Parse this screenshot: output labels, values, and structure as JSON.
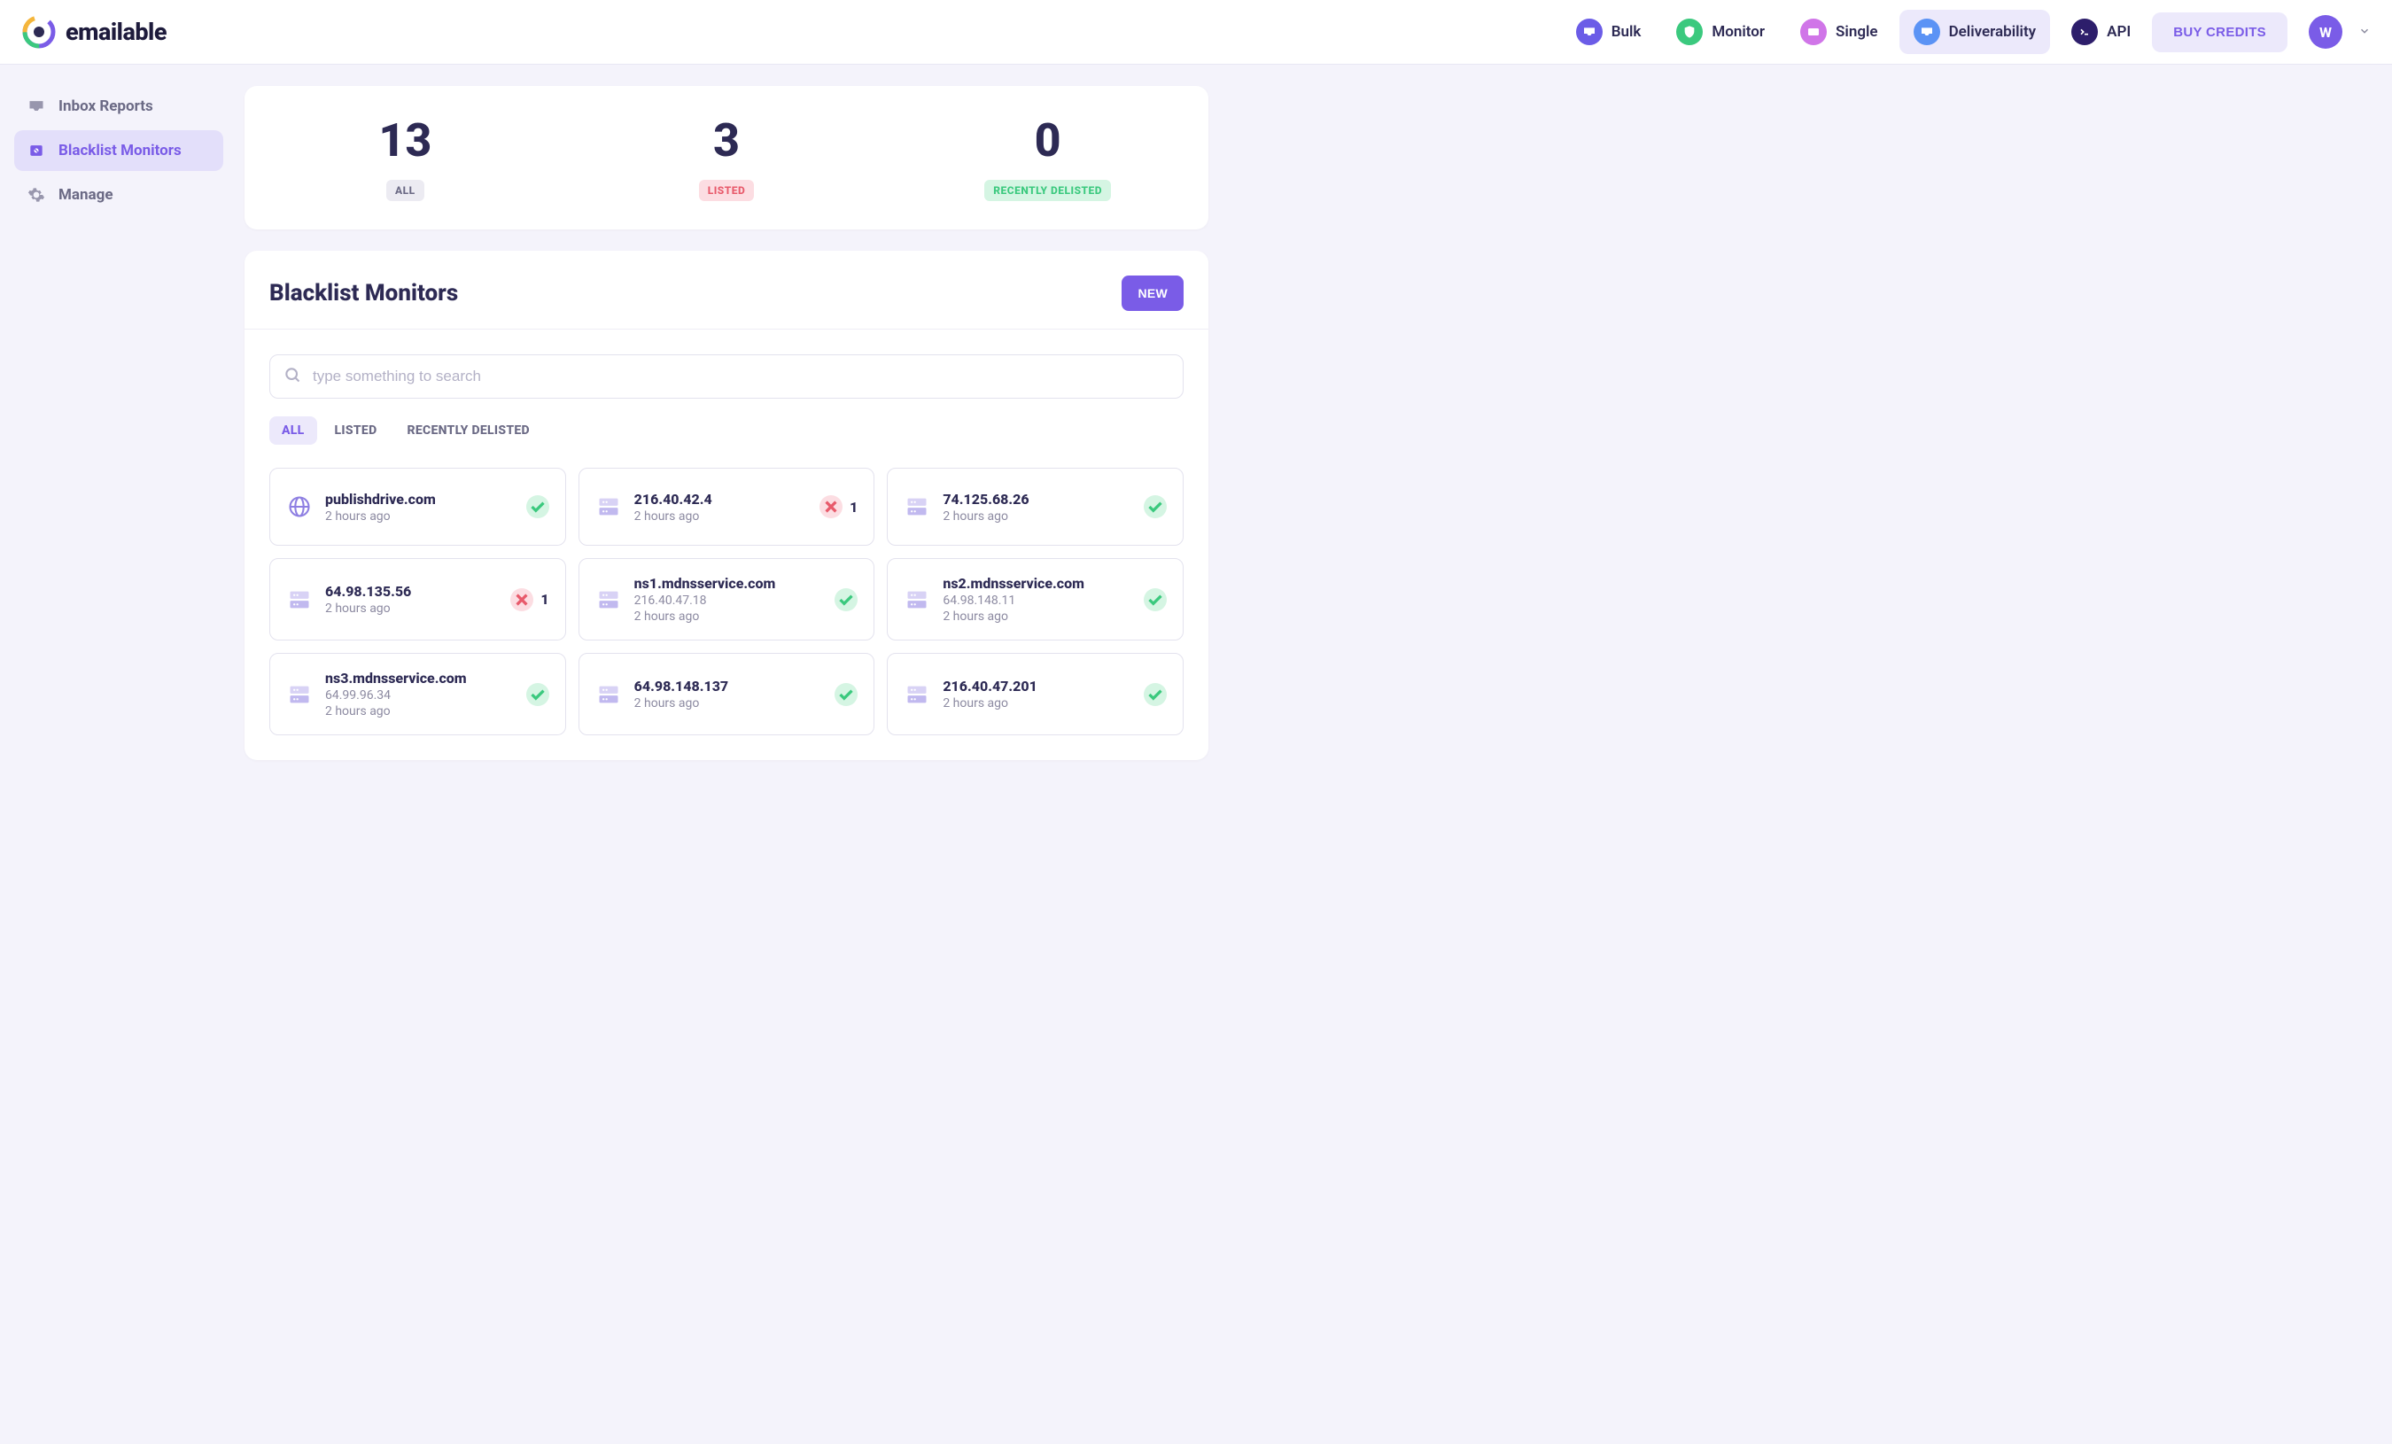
{
  "brand": "emailable",
  "nav": {
    "items": [
      {
        "label": "Bulk",
        "color": "purple",
        "icon": "inbox"
      },
      {
        "label": "Monitor",
        "color": "green",
        "icon": "shield"
      },
      {
        "label": "Single",
        "color": "pink",
        "icon": "envelope"
      },
      {
        "label": "Deliverability",
        "color": "blue",
        "icon": "inbox",
        "active": true
      },
      {
        "label": "API",
        "color": "darknavy",
        "icon": "terminal"
      }
    ],
    "buy_credits": "BUY CREDITS",
    "user_initial": "W"
  },
  "sidebar": {
    "items": [
      {
        "label": "Inbox Reports",
        "icon": "inbox"
      },
      {
        "label": "Blacklist Monitors",
        "icon": "blacklist",
        "active": true
      },
      {
        "label": "Manage",
        "icon": "gear"
      }
    ]
  },
  "stats": [
    {
      "value": "13",
      "label": "ALL",
      "class": "badge-all"
    },
    {
      "value": "3",
      "label": "LISTED",
      "class": "badge-listed"
    },
    {
      "value": "0",
      "label": "RECENTLY DELISTED",
      "class": "badge-delisted"
    }
  ],
  "list": {
    "title": "Blacklist Monitors",
    "new_button": "NEW",
    "search_placeholder": "type something to search",
    "filter_pills": [
      {
        "label": "ALL",
        "active": true
      },
      {
        "label": "LISTED"
      },
      {
        "label": "RECENTLY DELISTED"
      }
    ],
    "monitors": [
      {
        "name": "publishdrive.com",
        "sub": "",
        "time": "2 hours ago",
        "icon": "globe",
        "status": "ok"
      },
      {
        "name": "216.40.42.4",
        "sub": "",
        "time": "2 hours ago",
        "icon": "server",
        "status": "bad",
        "count": "1"
      },
      {
        "name": "74.125.68.26",
        "sub": "",
        "time": "2 hours ago",
        "icon": "server",
        "status": "ok"
      },
      {
        "name": "64.98.135.56",
        "sub": "",
        "time": "2 hours ago",
        "icon": "server",
        "status": "bad",
        "count": "1"
      },
      {
        "name": "ns1.mdnsservice.com",
        "sub": "216.40.47.18",
        "time": "2 hours ago",
        "icon": "server",
        "status": "ok"
      },
      {
        "name": "ns2.mdnsservice.com",
        "sub": "64.98.148.11",
        "time": "2 hours ago",
        "icon": "server",
        "status": "ok"
      },
      {
        "name": "ns3.mdnsservice.com",
        "sub": "64.99.96.34",
        "time": "2 hours ago",
        "icon": "server",
        "status": "ok"
      },
      {
        "name": "64.98.148.137",
        "sub": "",
        "time": "2 hours ago",
        "icon": "server",
        "status": "ok"
      },
      {
        "name": "216.40.47.201",
        "sub": "",
        "time": "2 hours ago",
        "icon": "server",
        "status": "ok"
      }
    ]
  }
}
